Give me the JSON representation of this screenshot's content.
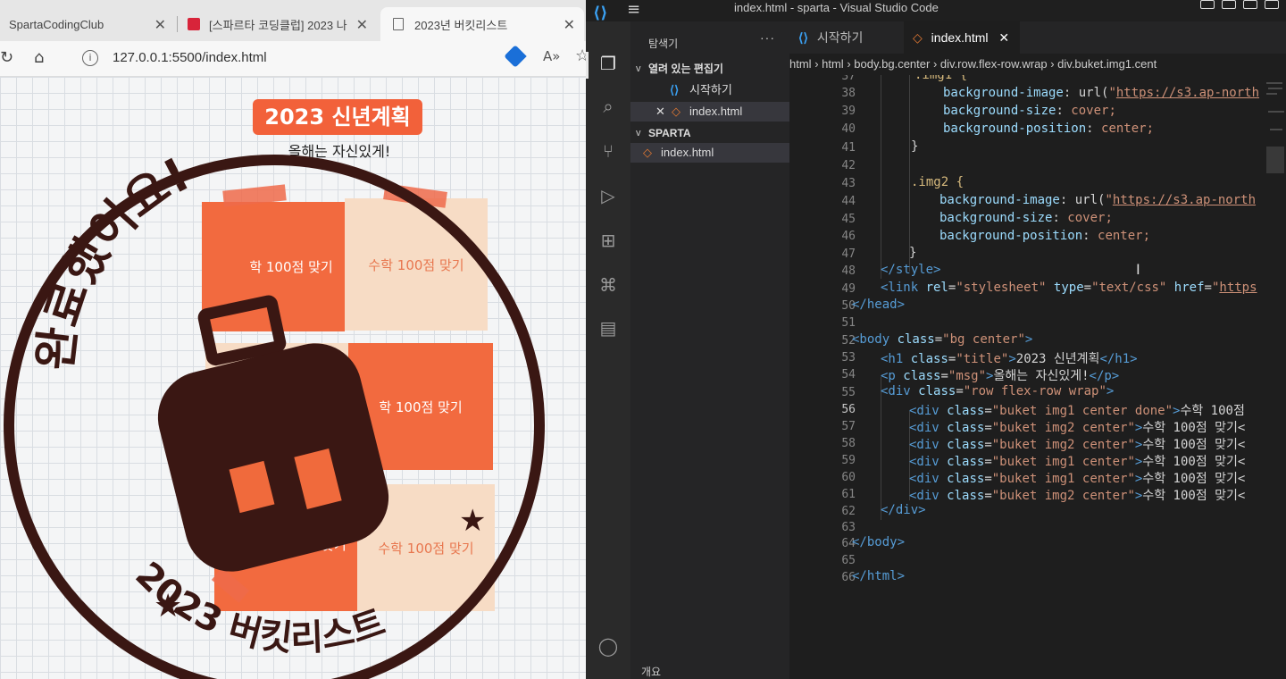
{
  "browser": {
    "tabs": [
      {
        "label": "SpartaCodingClub"
      },
      {
        "label": "[스파르타 코딩클럽] 2023 나"
      },
      {
        "label": "2023년 버킷리스트"
      }
    ],
    "url": "127.0.0.1:5500/index.html",
    "page": {
      "title": "2023 신년계획",
      "msg": "올해는 자신있게!",
      "buckets": [
        {
          "label": "학 100점 맞기"
        },
        {
          "label": "수학 100점 맞기"
        },
        {
          "label": "학 100점 맞기"
        },
        {
          "label": "0점 맞기"
        },
        {
          "label": "수학 100점 맞기"
        }
      ],
      "stamp": {
        "top_text": "완료했어요!",
        "bottom_text": "2023 버킷리스트"
      }
    }
  },
  "vscode": {
    "title": "index.html - sparta - Visual Studio Code",
    "explorer": {
      "title": "탐색기",
      "more": "···",
      "open_editors": "열려 있는 편집기",
      "open_items": [
        "시작하기",
        "index.html"
      ],
      "folder": "SPARTA",
      "files": [
        "index.html"
      ],
      "bottom": "개요"
    },
    "tabs": [
      {
        "label": "시작하기"
      },
      {
        "label": "index.html"
      }
    ],
    "breadcrumb": [
      "html",
      "html",
      "body.bg.center",
      "div.row.flex-row.wrap",
      "div.buket.img1.cent"
    ],
    "line_numbers": [
      "37",
      "38",
      "39",
      "40",
      "41",
      "42",
      "43",
      "44",
      "45",
      "46",
      "47",
      "48",
      "49",
      "50",
      "51",
      "52",
      "53",
      "54",
      "55",
      "56",
      "57",
      "58",
      "59",
      "60",
      "61",
      "62",
      "63",
      "64",
      "65",
      "66"
    ],
    "code": {
      "l37": ".img1 {",
      "l38_prop": "background-image",
      "l38_url": "https://s3.ap-north",
      "l39_prop": "background-size",
      "l39_val": "cover;",
      "l40_prop": "background-position",
      "l40_val": "center;",
      "l41": "}",
      "l43": ".img2 {",
      "l44_prop": "background-image",
      "l44_url": "https://s3.ap-north",
      "l45_prop": "background-size",
      "l45_val": "cover;",
      "l46_prop": "background-position",
      "l46_val": "center;",
      "l47": "}",
      "l48": "</style>",
      "l49_attr1": "rel",
      "l49_val1": "\"stylesheet\"",
      "l49_attr2": "type",
      "l49_val2": "\"text/css\"",
      "l49_attr3": "href",
      "l49_url": "https",
      "l50": "</head>",
      "l52_val": "\"bg center\"",
      "l53_val": "\"title\"",
      "l53_txt": "2023 신년계획",
      "l54_val": "\"msg\"",
      "l54_txt": "올해는 자신있게!",
      "l55_val": "\"row flex-row wrap\"",
      "l56_val": "\"buket img1 center done\"",
      "l56_txt": "수학 100점",
      "l57_val": "\"buket img2 center\"",
      "l58_val": "\"buket img2 center\"",
      "l59_val": "\"buket img1 center\"",
      "l60_val": "\"buket img1 center\"",
      "l61_val": "\"buket img2 center\"",
      "row_txt": "수학 100점 맞기<",
      "l62": "</div>",
      "l64": "</body>",
      "l66": "</html>"
    }
  },
  "colors": {
    "accent_orange": "#f2613a",
    "stamp": "#3a1713",
    "vscode_blue": "#3aa0f2"
  }
}
